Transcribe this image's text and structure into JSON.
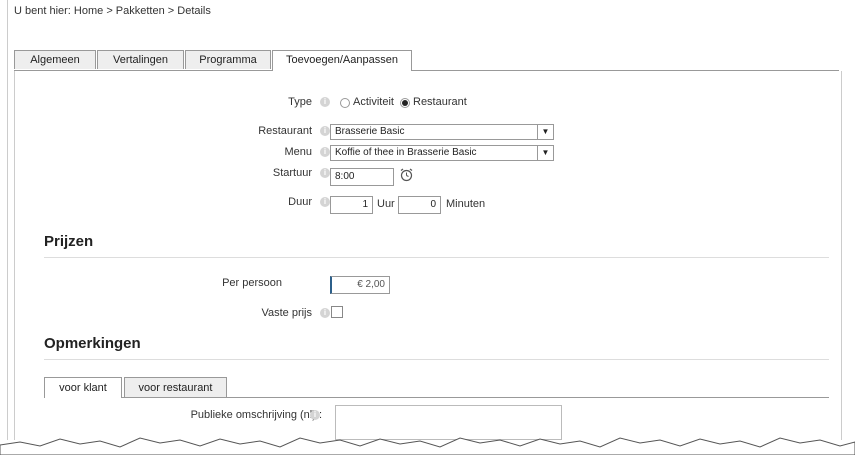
{
  "breadcrumb": "U bent hier: Home > Pakketten > Details",
  "tabs": [
    "Algemeen",
    "Vertalingen",
    "Programma",
    "Toevoegen/Aanpassen"
  ],
  "form": {
    "type_label": "Type",
    "type_options": [
      "Activiteit",
      "Restaurant"
    ],
    "type_selected": "Restaurant",
    "restaurant_label": "Restaurant",
    "restaurant_value": "Brasserie Basic",
    "menu_label": "Menu",
    "menu_value": "Koffie of thee in Brasserie Basic",
    "startuur_label": "Startuur",
    "startuur_value": "8:00",
    "duur_label": "Duur",
    "duur_hours": "1",
    "duur_hours_unit": "Uur",
    "duur_minutes": "0",
    "duur_minutes_unit": "Minuten"
  },
  "prices": {
    "heading": "Prijzen",
    "per_persoon_label": "Per persoon",
    "per_persoon_value": "€ 2,00",
    "vaste_prijs_label": "Vaste prijs"
  },
  "remarks": {
    "heading": "Opmerkingen",
    "subtabs": [
      "voor klant",
      "voor restaurant"
    ],
    "public_desc_label": "Publieke omschrijving (nl) :"
  },
  "colors": {
    "accent": "#2c5f8a",
    "border": "#999999"
  }
}
